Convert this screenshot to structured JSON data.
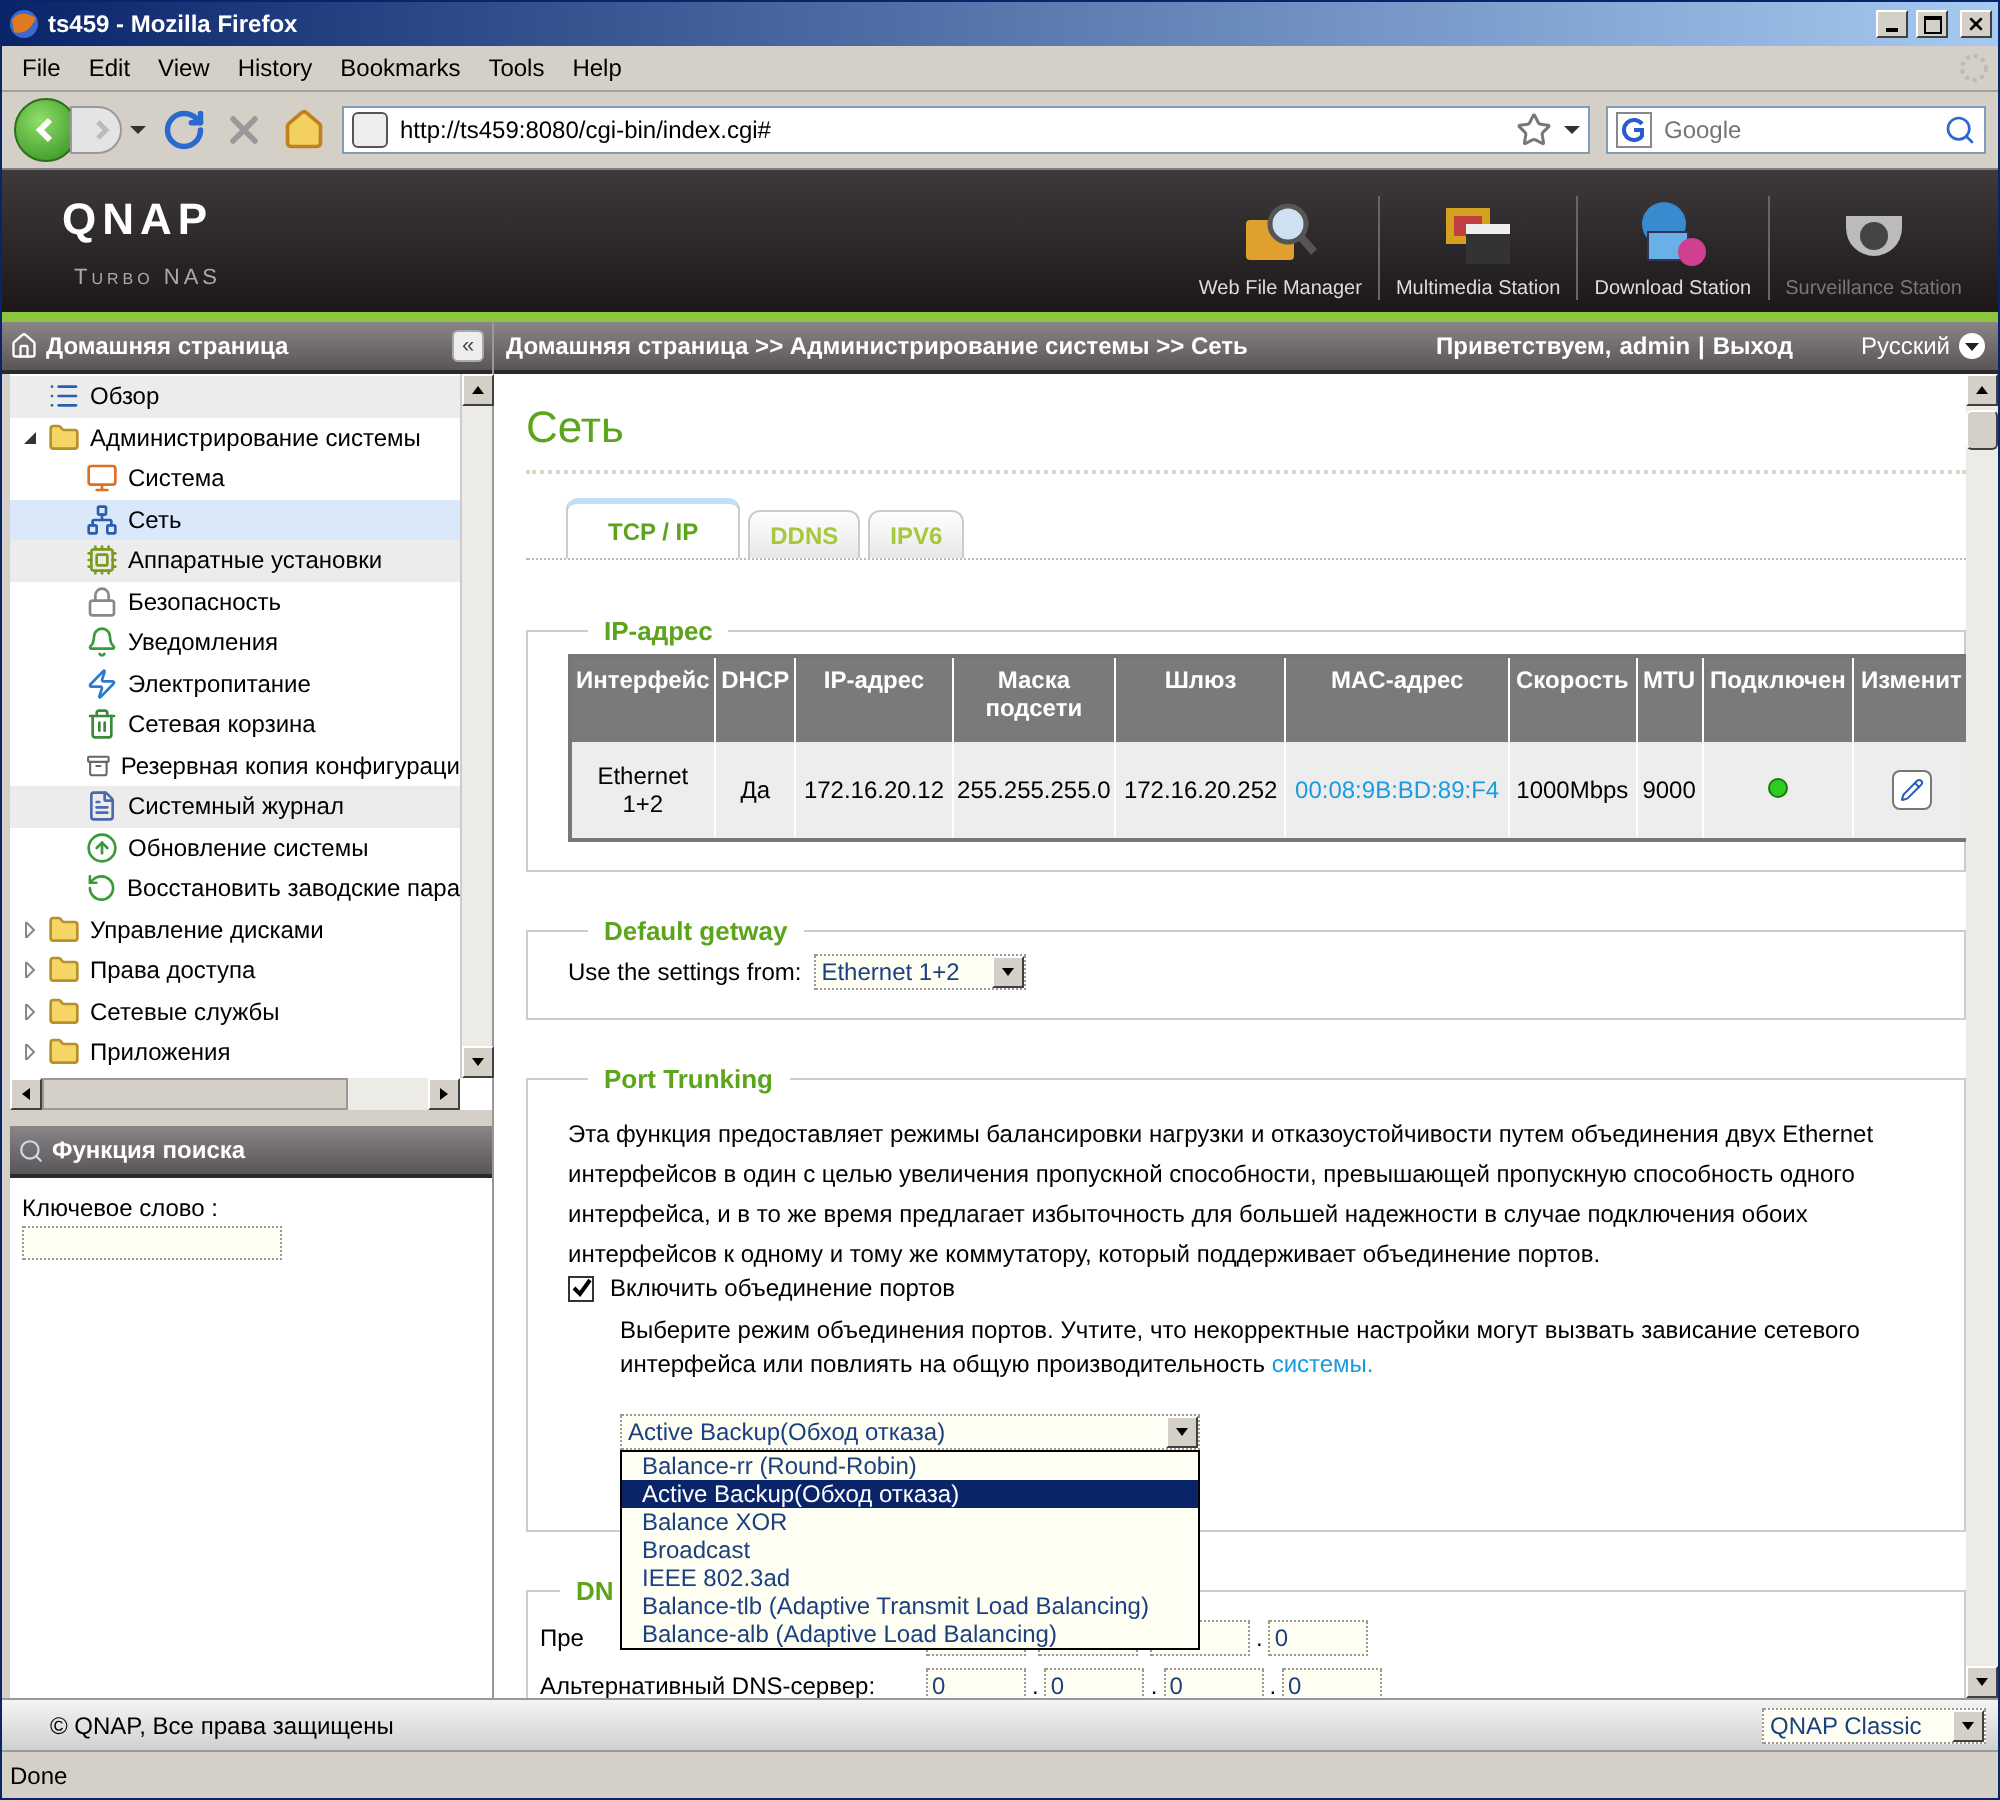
{
  "browser": {
    "title": "ts459 - Mozilla Firefox",
    "menu": [
      "File",
      "Edit",
      "View",
      "History",
      "Bookmarks",
      "Tools",
      "Help"
    ],
    "url": "http://ts459:8080/cgi-bin/index.cgi#",
    "search": {
      "placeholder": "Google"
    },
    "status": "Done"
  },
  "header": {
    "logo": "QNAP",
    "subtitle": "Turbo NAS",
    "apps": [
      {
        "label": "Web File Manager",
        "disabled": false
      },
      {
        "label": "Multimedia Station",
        "disabled": false
      },
      {
        "label": "Download Station",
        "disabled": false
      },
      {
        "label": "Surveillance Station",
        "disabled": true
      }
    ]
  },
  "sidebar": {
    "title": "Домашняя страница",
    "collapse": "«",
    "tree": [
      {
        "label": "Обзор",
        "kind": "page",
        "selected": false,
        "highlighted": true
      },
      {
        "label": "Администрирование системы",
        "kind": "folder",
        "expanded": true,
        "children": [
          {
            "label": "Система",
            "selected": false,
            "highlighted": false
          },
          {
            "label": "Сеть",
            "selected": true,
            "highlighted": false
          },
          {
            "label": "Аппаратные установки",
            "selected": false,
            "highlighted": true
          },
          {
            "label": "Безопасность",
            "selected": false,
            "highlighted": false
          },
          {
            "label": "Уведомления",
            "selected": false,
            "highlighted": false
          },
          {
            "label": "Электропитание",
            "selected": false,
            "highlighted": false
          },
          {
            "label": "Сетевая корзина",
            "selected": false,
            "highlighted": false
          },
          {
            "label": "Резервная копия конфигураци",
            "selected": false,
            "highlighted": false
          },
          {
            "label": "Системный журнал",
            "selected": false,
            "highlighted": true
          },
          {
            "label": "Обновление системы",
            "selected": false,
            "highlighted": false
          },
          {
            "label": "Восстановить заводские пара",
            "selected": false,
            "highlighted": false
          }
        ]
      },
      {
        "label": "Управление дисками",
        "kind": "folder",
        "expanded": false
      },
      {
        "label": "Права доступа",
        "kind": "folder",
        "expanded": false
      },
      {
        "label": "Сетевые службы",
        "kind": "folder",
        "expanded": false
      },
      {
        "label": "Приложения",
        "kind": "folder",
        "expanded": false
      }
    ],
    "search": {
      "title": "Функция поиска",
      "label": "Ключевое слово :"
    }
  },
  "breadcrumb": "Домашняя страница >> Администрирование системы >> Сеть",
  "user": {
    "greeting": "Приветствуем,",
    "name": "admin",
    "separator": "|",
    "logout": "Выход",
    "language": "Русский"
  },
  "page_title": "Сеть",
  "tabs": [
    {
      "label": "TCP / IP",
      "selected": true
    },
    {
      "label": "DDNS",
      "selected": false
    },
    {
      "label": "IPV6",
      "selected": false
    }
  ],
  "ip_section": {
    "title": "IP-адрес",
    "columns": [
      "Интерфейс",
      "DHCP",
      "IP-адрес",
      "Маска подсети",
      "Шлюз",
      "MAC-адрес",
      "Скорость",
      "MTU",
      "Подключен",
      "Изменит"
    ],
    "rows": [
      {
        "interface": "Ethernet 1+2",
        "dhcp": "Да",
        "ip": "172.16.20.12",
        "mask": "255.255.255.0",
        "gateway": "172.16.20.252",
        "mac": "00:08:9B:BD:89:F4",
        "speed": "1000Mbps",
        "mtu": "9000",
        "connected": true
      }
    ]
  },
  "gateway_section": {
    "title": "Default getway",
    "label": "Use the settings from:",
    "value": "Ethernet 1+2"
  },
  "trunking_section": {
    "title": "Port Trunking",
    "description": "Эта функция предоставляет режимы балансировки нагрузки и отказоустойчивости путем объединения двух Ethernet интерфейсов в один с целью увеличения пропускной способности, превышающей пропускную способность одного интерфейса, и в то же время предлагает избыточность для большей надежности в случае подключения обоих интерфейсов к одному и тому же коммутатору, который поддерживает объединение портов.",
    "enable": {
      "label": "Включить объединение портов",
      "checked": true
    },
    "hint": "Выберите режим объединения портов. Учтите, что некорректные настройки могут вызвать зависание сетевого интерфейса или повлиять на общую производительность",
    "hint_link": "системы.",
    "mode": "Active Backup(Обход отказа)",
    "options": [
      {
        "label": "Balance-rr (Round-Robin)",
        "selected": false
      },
      {
        "label": "Active Backup(Обход отказа)",
        "selected": true
      },
      {
        "label": "Balance XOR",
        "selected": false
      },
      {
        "label": "Broadcast",
        "selected": false
      },
      {
        "label": "IEEE 802.3ad",
        "selected": false
      },
      {
        "label": "Balance-tlb (Adaptive Transmit Load Balancing)",
        "selected": false
      },
      {
        "label": "Balance-alb (Adaptive Load Balancing)",
        "selected": false
      }
    ]
  },
  "dns_section": {
    "title": "DN",
    "separator": ".",
    "rows": [
      {
        "label": "Пре",
        "fields": [
          "0"
        ]
      },
      {
        "label": "Альтернативный DNS-сервер:",
        "fields": [
          "0",
          "0",
          "0",
          "0"
        ]
      }
    ]
  },
  "footer": {
    "copyright": "© QNAP, Все права защищены",
    "theme": "QNAP Classic"
  }
}
